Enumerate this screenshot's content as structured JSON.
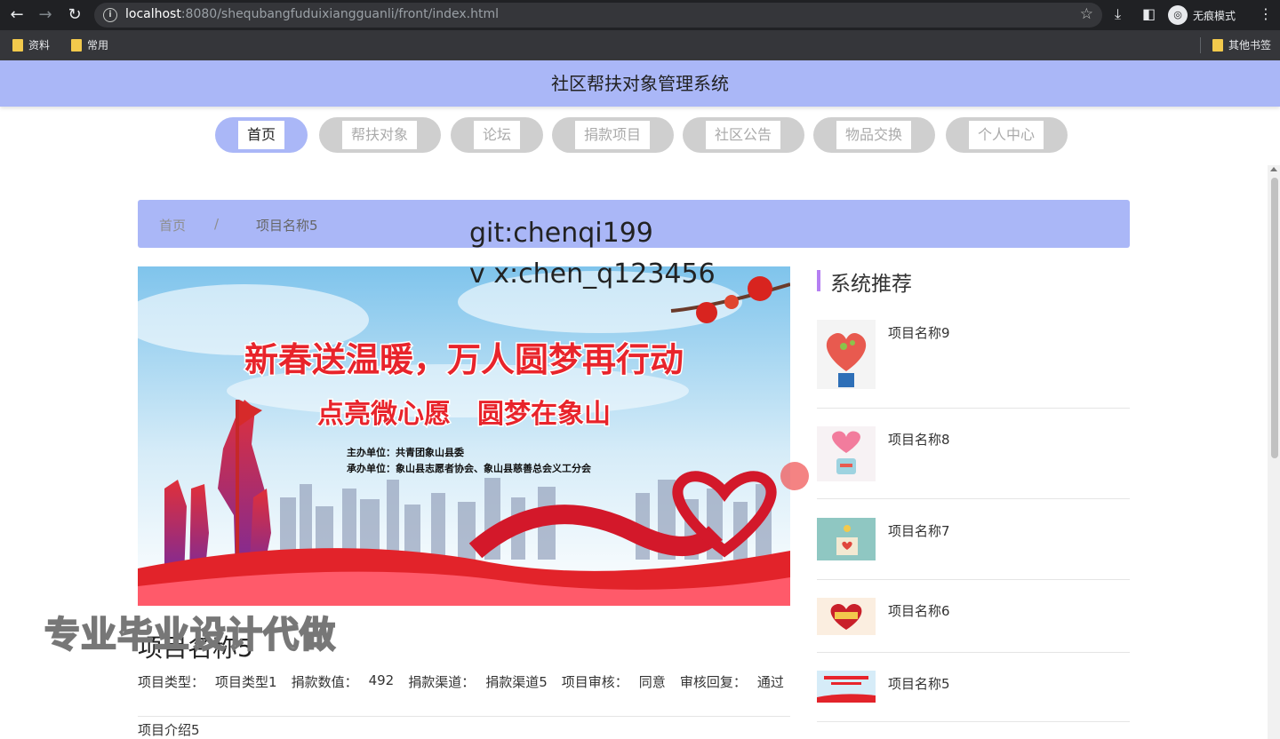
{
  "browser": {
    "url_host": "localhost",
    "url_path": ":8080/shequbangfuduixiangguanli/front/index.html",
    "incognito_label": "无痕模式",
    "bookmarks": [
      "资料",
      "常用"
    ],
    "other_bookmarks": "其他书签"
  },
  "site": {
    "title": "社区帮扶对象管理系统",
    "nav": [
      "首页",
      "帮扶对象",
      "论坛",
      "捐款项目",
      "社区公告",
      "物品交换",
      "个人中心"
    ]
  },
  "breadcrumb": {
    "home": "首页",
    "sep": "/",
    "current": "项目名称5"
  },
  "watermarks": {
    "git": "git:chenqi199",
    "vx": "v x:chen_q123456",
    "ad": "专业毕业设计代做"
  },
  "banner": {
    "headline": "新春送温暖，万人圆梦再行动",
    "subhead": "点亮微心愿　圆梦在象山",
    "host": "主办单位：共青团象山县委",
    "organizer": "承办单位：象山县志愿者协会、象山县慈善总会义工分会"
  },
  "detail": {
    "title": "项目名称5",
    "type_label": "项目类型：",
    "type_value": "项目类型1",
    "amount_label": "捐款数值：",
    "amount_value": "492",
    "channel_label": "捐款渠道：",
    "channel_value": "捐款渠道5",
    "audit_label": "项目审核：",
    "audit_value": "同意",
    "reply_label": "审核回复：",
    "reply_value": "通过",
    "intro": "项目介绍5"
  },
  "recommend": {
    "title": "系统推荐",
    "items": [
      "项目名称9",
      "项目名称8",
      "项目名称7",
      "项目名称6",
      "项目名称5"
    ]
  },
  "colors": {
    "accent": "#aab7f7",
    "recommend_bar": "#b57ff2",
    "pill_inactive": "#cfcfcf"
  }
}
